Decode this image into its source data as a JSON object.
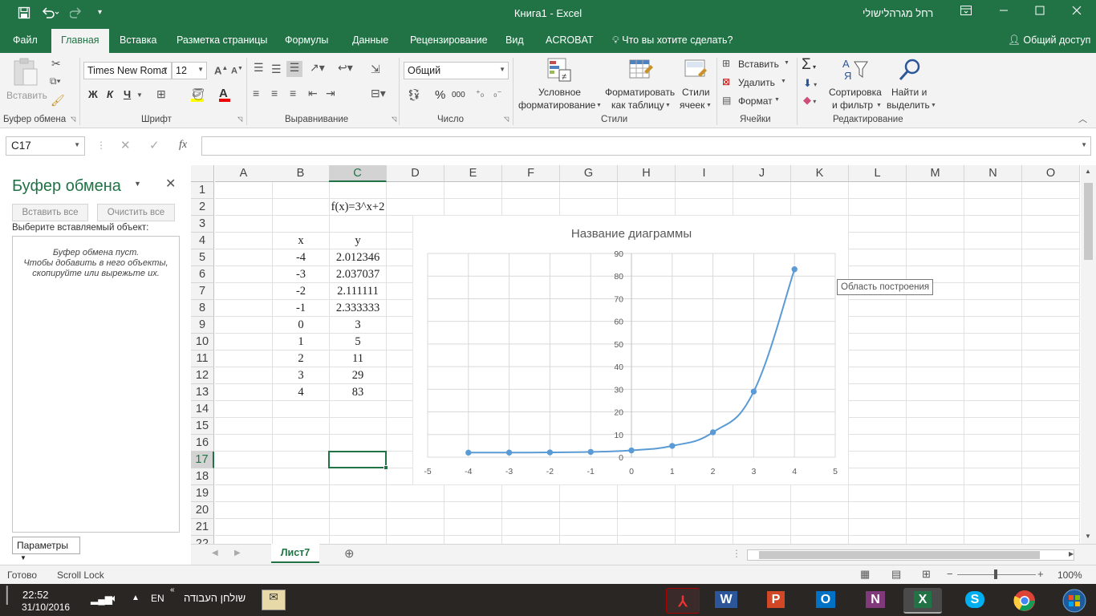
{
  "titlebar": {
    "title": "Книга1  -  Excel",
    "user": "רחל מגרהלישולי",
    "customize": "▾"
  },
  "tabs": {
    "items": [
      "Файл",
      "Главная",
      "Вставка",
      "Разметка страницы",
      "Формулы",
      "Данные",
      "Рецензирование",
      "Вид",
      "ACROBAT"
    ],
    "tell_me": "Что вы хотите сделать?",
    "share": "Общий доступ"
  },
  "ribbon": {
    "clipboard": {
      "paste": "Вставить",
      "label": "Буфер обмена"
    },
    "font": {
      "name": "Times New Roma",
      "size": "12",
      "bold": "Ж",
      "italic": "К",
      "underline": "Ч",
      "label": "Шрифт"
    },
    "alignment": {
      "label": "Выравнивание"
    },
    "number": {
      "format": "Общий",
      "label": "Число",
      "percent": "%",
      "thousands": "000"
    },
    "styles": {
      "conditional_1": "Условное",
      "conditional_2": "форматирование",
      "table_1": "Форматировать",
      "table_2": "как таблицу",
      "cell_1": "Стили",
      "cell_2": "ячеек",
      "label": "Стили"
    },
    "cells": {
      "insert": "Вставить",
      "delete": "Удалить",
      "format": "Формат",
      "label": "Ячейки"
    },
    "editing": {
      "sort_1": "Сортировка",
      "sort_2": "и фильтр",
      "find_1": "Найти и",
      "find_2": "выделить",
      "label": "Редактирование"
    }
  },
  "formula_bar": {
    "name_box": "C17",
    "fx": "fx",
    "value": ""
  },
  "clipboard_pane": {
    "title": "Буфер обмена",
    "paste_all": "Вставить все",
    "clear_all": "Очистить все",
    "prompt": "Выберите вставляемый объект:",
    "empty_1": "Буфер обмена пуст.",
    "empty_2": "Чтобы добавить в него объекты,",
    "empty_3": "скопируйте или вырежьте их.",
    "options": "Параметры"
  },
  "grid": {
    "columns": [
      "A",
      "B",
      "C",
      "D",
      "E",
      "F",
      "G",
      "H",
      "I",
      "J",
      "K",
      "L",
      "M",
      "N",
      "O"
    ],
    "rows": [
      "1",
      "2",
      "3",
      "4",
      "5",
      "6",
      "7",
      "8",
      "9",
      "10",
      "11",
      "12",
      "13",
      "14",
      "15",
      "16",
      "17",
      "18",
      "19",
      "20",
      "21",
      "22"
    ],
    "selected_cell": "C17",
    "cells": {
      "C2": "f(x)=3^x+2",
      "B4": "x",
      "C4": "y",
      "B5": "-4",
      "C5": "2.012346",
      "B6": "-3",
      "C6": "2.037037",
      "B7": "-2",
      "C7": "2.111111",
      "B8": "-1",
      "C8": "2.333333",
      "B9": "0",
      "C9": "3",
      "B10": "1",
      "C10": "5",
      "B11": "2",
      "C11": "11",
      "B12": "3",
      "C12": "29",
      "B13": "4",
      "C13": "83"
    }
  },
  "chart_data": {
    "type": "scatter",
    "title": "Название диаграммы",
    "x": [
      -4,
      -3,
      -2,
      -1,
      0,
      1,
      2,
      3,
      4
    ],
    "y": [
      2.012346,
      2.037037,
      2.111111,
      2.333333,
      3,
      5,
      11,
      29,
      83
    ],
    "xlim": [
      -5,
      5
    ],
    "ylim": [
      0,
      90
    ],
    "xticks": [
      -5,
      -4,
      -3,
      -2,
      -1,
      0,
      1,
      2,
      3,
      4,
      5
    ],
    "yticks": [
      0,
      10,
      20,
      30,
      40,
      50,
      60,
      70,
      80,
      90
    ],
    "grid": true,
    "line_color": "#5b9bd5",
    "smooth_line": true,
    "markers": true
  },
  "chart_tooltip": "Область построения",
  "sheet_tab": "Лист7",
  "status": {
    "ready": "Готово",
    "scroll_lock": "Scroll Lock",
    "zoom": "100%"
  },
  "taskbar": {
    "time": "22:52",
    "date": "31/10/2016",
    "lang": "EN",
    "desktop": "שולחן העבודה"
  },
  "colors": {
    "excel_green": "#217346",
    "chart_series": "#5b9bd5"
  }
}
